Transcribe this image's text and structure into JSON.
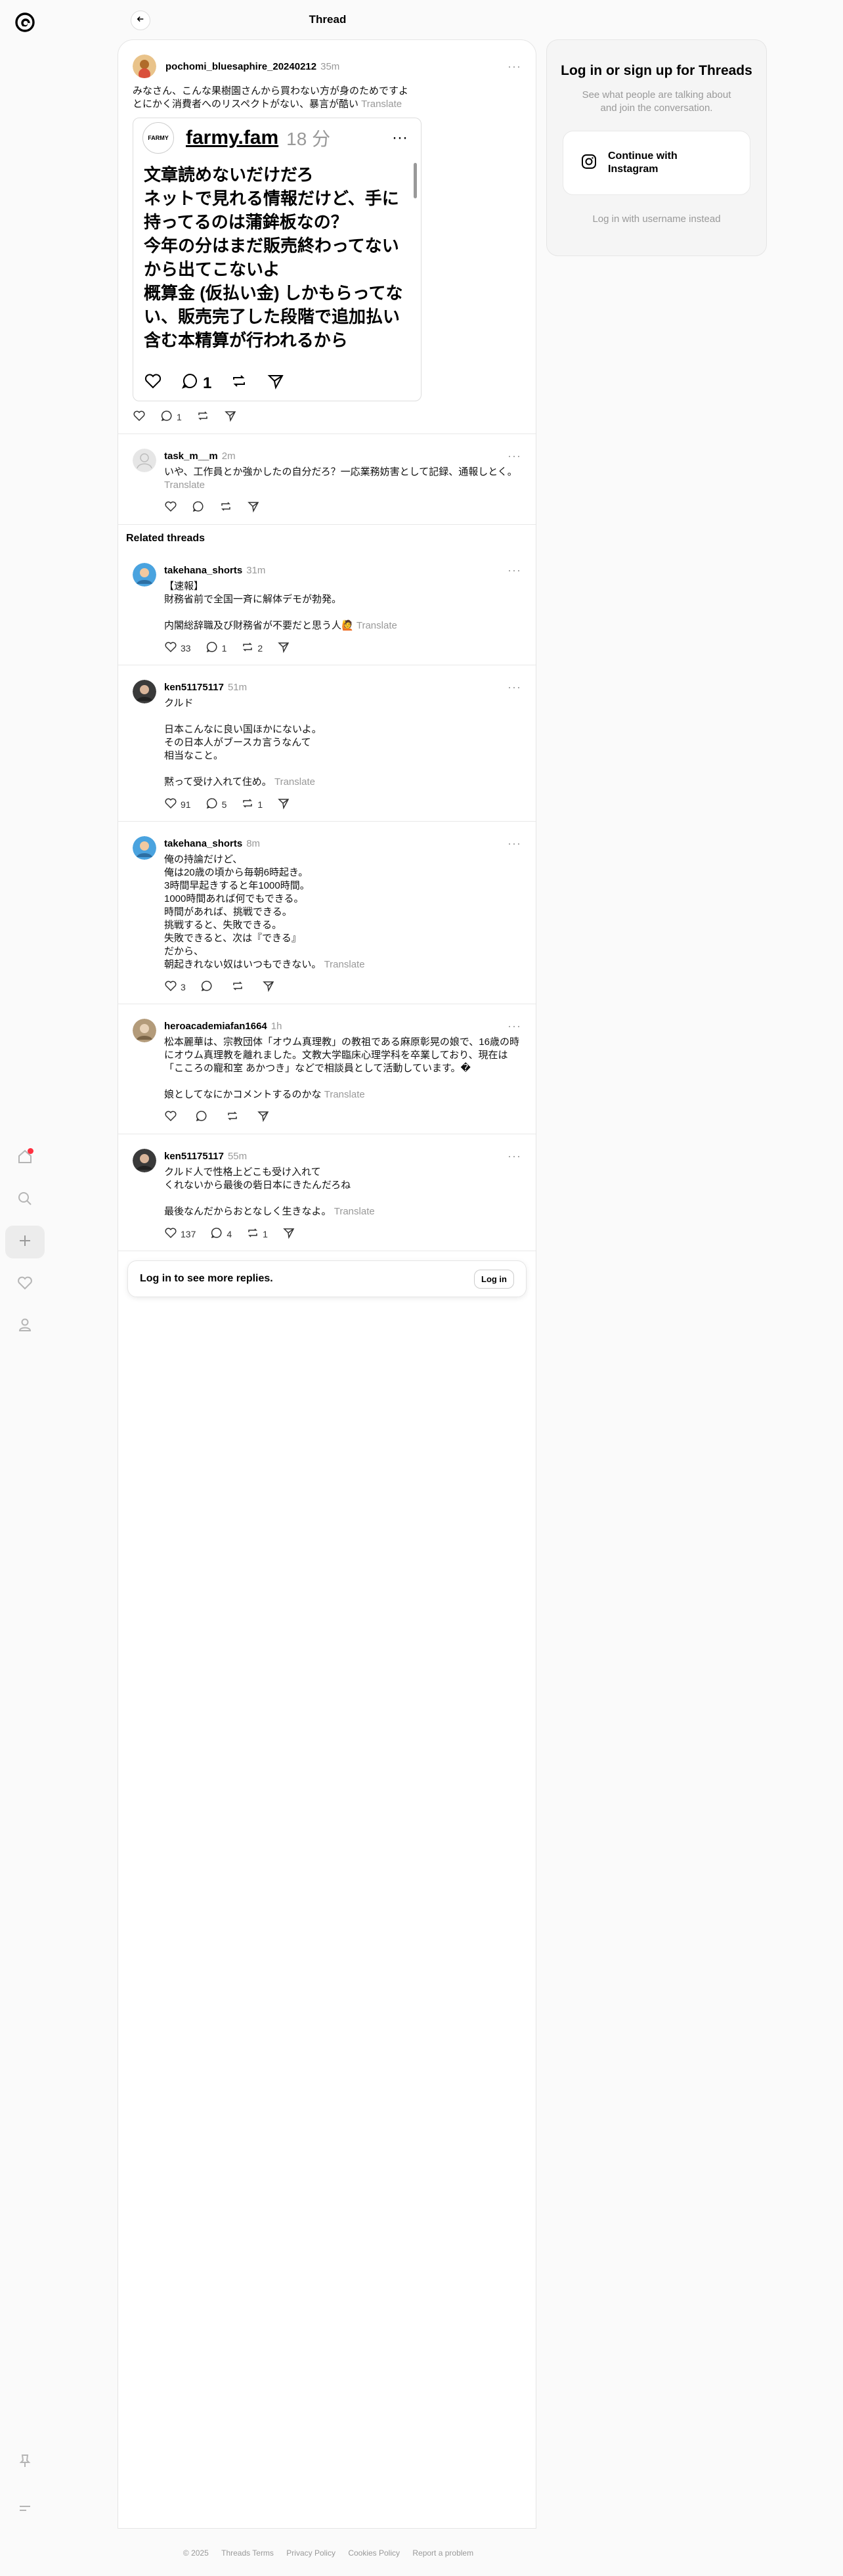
{
  "header": {
    "title": "Thread"
  },
  "nav": {
    "home": "home-icon",
    "search": "search-icon",
    "create": "plus-icon",
    "activity": "heart-icon",
    "profile": "profile-icon",
    "pin": "pin-icon",
    "menu": "menu-icon"
  },
  "main_post": {
    "username": "pochomi_bluesaphire_20240212",
    "time": "35m",
    "text": "みなさん、こんな果樹園さんから買わない方が身のためですよ\nとにかく消費者へのリスペクトがない、暴言が酷い",
    "translate": "Translate",
    "likes": "",
    "replies": "1",
    "reposts": "",
    "quoted": {
      "avatar_text": "FARMY",
      "username": "farmy.fam",
      "time": "18 分",
      "text": "文章読めないだけだろ\nネットで見れる情報だけど、手に持ってるのは蒲鉾板なの？\n今年の分はまだ販売終わってないから出てこないよ\n概算金 (仮払い金) しかもらってない、販売完了した段階で追加払い含む本精算が行われるから",
      "replies": "1"
    }
  },
  "reply": {
    "username": "task_m__m",
    "time": "2m",
    "text": "いや、工作員とか強かしたの自分だろ？一応業務妨害として記録、通報しとく。",
    "translate": "Translate"
  },
  "related_title": "Related threads",
  "related": [
    {
      "username": "takehana_shorts",
      "time": "31m",
      "text": "【速報】\n財務省前で全国一斉に解体デモが勃発。\n\n内閣総辞職及び財務省が不要だと思う人🙋",
      "translate": "Translate",
      "likes": "33",
      "replies": "1",
      "reposts": "2"
    },
    {
      "username": "ken51175117",
      "time": "51m",
      "text": "クルド\n\n日本こんなに良い国ほかにないよ。\nその日本人がブースカ言うなんて\n相当なこと。\n\n黙って受け入れて住め。",
      "translate": "Translate",
      "likes": "91",
      "replies": "5",
      "reposts": "1"
    },
    {
      "username": "takehana_shorts",
      "time": "8m",
      "text": "俺の持論だけど、\n俺は20歳の頃から毎朝6時起き。\n3時間早起きすると年1000時間。\n1000時間あれば何でもできる。\n時間があれば、挑戦できる。\n挑戦すると、失敗できる。\n失敗できると、次は『できる』\nだから、\n朝起きれない奴はいつもできない。",
      "translate": "Translate",
      "likes": "3",
      "replies": "",
      "reposts": ""
    },
    {
      "username": "heroacademiafan1664",
      "time": "1h",
      "text": "松本麗華は、宗教団体「オウム真理教」の教祖である麻原彰晃の娘で、16歳の時にオウム真理教を離れました。文教大学臨床心理学科を卒業しており、現在は「こころの寵和室 あかつき」などで相談員として活動しています。�\n\n娘としてなにかコメントするのかな",
      "translate": "Translate",
      "likes": "",
      "replies": "",
      "reposts": ""
    },
    {
      "username": "ken51175117",
      "time": "55m",
      "text": "クルド人で性格上どこも受け入れて\nくれないから最後の砦日本にきたんだろね\n\n最後なんだからおとなしく生きなよ。",
      "translate": "Translate",
      "likes": "137",
      "replies": "4",
      "reposts": "1"
    }
  ],
  "login_bar": {
    "text": "Log in to see more replies.",
    "button": "Log in"
  },
  "side": {
    "title": "Log in or sign up for Threads",
    "subtitle": "See what people are talking about and join the conversation.",
    "instagram_button": "Continue with Instagram",
    "alt_login": "Log in with username instead"
  },
  "footer": {
    "copyright": "© 2025",
    "terms": "Threads Terms",
    "privacy": "Privacy Policy",
    "cookies": "Cookies Policy",
    "report": "Report a problem"
  },
  "colors": {
    "accent": "#ff3040",
    "muted": "#999999",
    "background": "#fafafa"
  }
}
